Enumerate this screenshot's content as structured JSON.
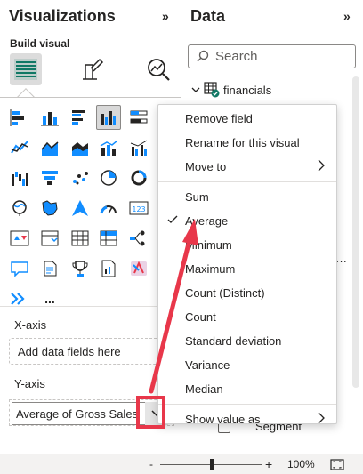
{
  "visualizations": {
    "title": "Visualizations",
    "collapse_glyph": "»",
    "build_label": "Build visual",
    "build_tabs": [
      {
        "name": "build-visual-icon",
        "active": true
      },
      {
        "name": "format-visual-icon",
        "active": false
      },
      {
        "name": "analytics-icon",
        "active": false
      }
    ],
    "more_label": "...",
    "xaxis": {
      "label": "X-axis",
      "placeholder": "Add data fields here"
    },
    "yaxis": {
      "label": "Y-axis",
      "field": "Average of Gross Sales"
    }
  },
  "data_pane": {
    "title": "Data",
    "collapse_glyph": "»",
    "search_placeholder": "Search",
    "table_name": "financials",
    "partial_text": "r",
    "more_dots": "···",
    "segment_label": "Segment"
  },
  "context_menu": {
    "items": [
      {
        "label": "Remove field"
      },
      {
        "label": "Rename for this visual"
      },
      {
        "label": "Move to",
        "submenu": true
      },
      {
        "label": "Sum"
      },
      {
        "label": "Average",
        "checked": true
      },
      {
        "label": "Minimum"
      },
      {
        "label": "Maximum"
      },
      {
        "label": "Count (Distinct)"
      },
      {
        "label": "Count"
      },
      {
        "label": "Standard deviation"
      },
      {
        "label": "Variance"
      },
      {
        "label": "Median"
      },
      {
        "label": "Show value as",
        "submenu": true
      }
    ]
  },
  "status_bar": {
    "zoom_minus": "-",
    "zoom_plus": "+",
    "zoom_level": "100%",
    "zoom_fraction": 0.5
  },
  "colors": {
    "accent": "#117865",
    "annotation": "#e8374a",
    "icon_blue": "#118dff",
    "icon_dark": "#252423"
  }
}
